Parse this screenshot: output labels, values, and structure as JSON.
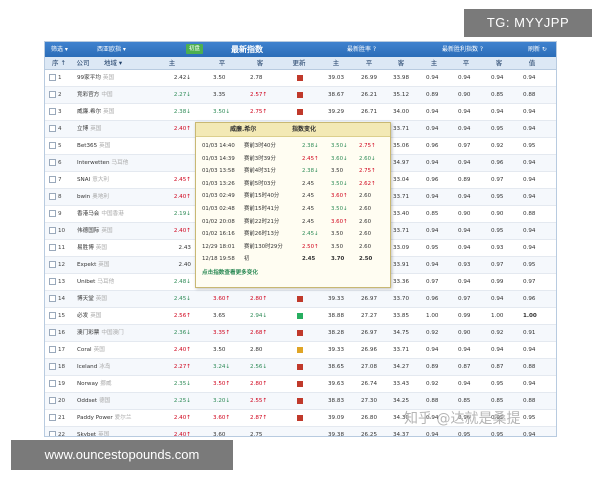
{
  "watermarks": {
    "top_right": "TG: MYYJPP",
    "bottom_left": "www.ouncestopounds.com",
    "zhihu": "知乎 @达就是桑提"
  },
  "toolbar": {
    "filter": "筛选 ▾",
    "region": "西亚欧指 ▾",
    "tag": "初盘",
    "title": "最新指数",
    "link1": "最新胜率 ?",
    "link2": "最新胜利指数 ?",
    "refresh": "刷新 ↻"
  },
  "header": {
    "seq": "序 ↑",
    "company": "公司",
    "region": "地域 ▾",
    "zhu": "主",
    "ping": "平",
    "ke": "客",
    "update": "更新",
    "zhu2": "主",
    "ping2": "平",
    "ke2": "客",
    "zhu3": "主",
    "ping3": "平",
    "ke3": "客",
    "val": "值"
  },
  "rows": [
    {
      "no": "1",
      "co": "99家平均",
      "rg": "英国",
      "zhu": "2.42↓",
      "zc": "blk",
      "ping": "3.50",
      "pc": "blk",
      "ke": "2.78",
      "kc": "blk",
      "upd": "#c0392b",
      "z2": "39.03",
      "p2": "26.99",
      "k2": "33.98",
      "z3": "0.94",
      "p3": "0.94",
      "k3": "0.94",
      "v": "0.94",
      "vb": false
    },
    {
      "no": "2",
      "co": "竞彩官方",
      "rg": "中国",
      "zhu": "2.27↓",
      "zc": "green",
      "ping": "3.35",
      "pc": "blk",
      "ke": "2.57↑",
      "kc": "red",
      "upd": "#c0392b",
      "z2": "38.67",
      "p2": "26.21",
      "k2": "35.12",
      "z3": "0.89",
      "p3": "0.90",
      "k3": "0.85",
      "v": "0.88",
      "vb": false
    },
    {
      "no": "3",
      "co": "威廉.希尔",
      "rg": "英国",
      "zhu": "2.38↓",
      "zc": "green",
      "ping": "3.50↓",
      "pc": "green",
      "ke": "2.75↑",
      "kc": "red",
      "upd": "#c0392b",
      "z2": "39.29",
      "p2": "26.71",
      "k2": "34.00",
      "z3": "0.94",
      "p3": "0.94",
      "k3": "0.94",
      "v": "0.94",
      "vb": false
    },
    {
      "no": "4",
      "co": "立博",
      "rg": "英国",
      "zhu": "2.40↑",
      "zc": "red",
      "ping": "3.50",
      "pc": "blk",
      "ke": "2.75↑",
      "kc": "red",
      "upd": "",
      "z2": "",
      "p2": "",
      "k2": "33.71",
      "z3": "0.94",
      "p3": "0.94",
      "k3": "0.95",
      "v": "0.94",
      "vb": false
    },
    {
      "no": "5",
      "co": "Bet365",
      "rg": "英国",
      "zhu": "",
      "zc": "blk",
      "ping": "",
      "pc": "blk",
      "ke": "",
      "kc": "blk",
      "upd": "",
      "z2": "",
      "p2": "",
      "k2": "35.06",
      "z3": "0.96",
      "p3": "0.97",
      "k3": "0.92",
      "v": "0.95",
      "vb": false
    },
    {
      "no": "6",
      "co": "Interwetten",
      "rg": "马耳他",
      "zhu": "",
      "zc": "blk",
      "ping": "",
      "pc": "blk",
      "ke": "",
      "kc": "blk",
      "upd": "",
      "z2": "",
      "p2": "",
      "k2": "34.97",
      "z3": "0.94",
      "p3": "0.94",
      "k3": "0.96",
      "v": "0.94",
      "vb": false
    },
    {
      "no": "7",
      "co": "SNAI",
      "rg": "意大利",
      "zhu": "2.45↑",
      "zc": "red",
      "ping": "",
      "pc": "blk",
      "ke": "",
      "kc": "blk",
      "upd": "",
      "z2": "",
      "p2": "",
      "k2": "33.04",
      "z3": "0.96",
      "p3": "0.89",
      "k3": "0.97",
      "v": "0.94",
      "vb": false
    },
    {
      "no": "8",
      "co": "bwin",
      "rg": "奥地利",
      "zhu": "2.40↑",
      "zc": "red",
      "ping": "",
      "pc": "blk",
      "ke": "",
      "kc": "blk",
      "upd": "",
      "z2": "",
      "p2": "",
      "k2": "33.71",
      "z3": "0.94",
      "p3": "0.94",
      "k3": "0.95",
      "v": "0.94",
      "vb": false
    },
    {
      "no": "9",
      "co": "香港马会",
      "rg": "中国香港",
      "zhu": "2.19↓",
      "zc": "green",
      "ping": "",
      "pc": "blk",
      "ke": "",
      "kc": "blk",
      "upd": "",
      "z2": "",
      "p2": "",
      "k2": "33.40",
      "z3": "0.85",
      "p3": "0.90",
      "k3": "0.90",
      "v": "0.88",
      "vb": false
    },
    {
      "no": "10",
      "co": "伟德国际",
      "rg": "英国",
      "zhu": "2.40↑",
      "zc": "red",
      "ping": "",
      "pc": "blk",
      "ke": "",
      "kc": "blk",
      "upd": "",
      "z2": "",
      "p2": "",
      "k2": "33.71",
      "z3": "0.94",
      "p3": "0.94",
      "k3": "0.95",
      "v": "0.94",
      "vb": false
    },
    {
      "no": "11",
      "co": "易胜博",
      "rg": "英国",
      "zhu": "2.43",
      "zc": "blk",
      "ping": "",
      "pc": "blk",
      "ke": "",
      "kc": "blk",
      "upd": "",
      "z2": "",
      "p2": "",
      "k2": "33.09",
      "z3": "0.95",
      "p3": "0.94",
      "k3": "0.93",
      "v": "0.94",
      "vb": false
    },
    {
      "no": "12",
      "co": "Expekt",
      "rg": "英国",
      "zhu": "2.40",
      "zc": "blk",
      "ping": "",
      "pc": "blk",
      "ke": "",
      "kc": "blk",
      "upd": "",
      "z2": "",
      "p2": "",
      "k2": "33.91",
      "z3": "0.94",
      "p3": "0.93",
      "k3": "0.97",
      "v": "0.95",
      "vb": false
    },
    {
      "no": "13",
      "co": "Unibet",
      "rg": "马耳他",
      "zhu": "2.48↓",
      "zc": "green",
      "ping": "3.50↑",
      "pc": "red",
      "ke": "2.90↑",
      "kc": "red",
      "upd": "#c0392b",
      "z2": "39.00",
      "p2": "27.64",
      "k2": "33.36",
      "z3": "0.97",
      "p3": "0.94",
      "k3": "0.99",
      "v": "0.97",
      "vb": false
    },
    {
      "no": "14",
      "co": "博天堂",
      "rg": "英国",
      "zhu": "2.45↓",
      "zc": "green",
      "ping": "3.60↑",
      "pc": "red",
      "ke": "2.80↑",
      "kc": "red",
      "upd": "#c0392b",
      "z2": "39.33",
      "p2": "26.97",
      "k2": "33.70",
      "z3": "0.96",
      "p3": "0.97",
      "k3": "0.94",
      "v": "0.96",
      "vb": false
    },
    {
      "no": "15",
      "co": "必发",
      "rg": "英国",
      "zhu": "2.56↑",
      "zc": "red",
      "ping": "3.65",
      "pc": "blk",
      "ke": "2.94↓",
      "kc": "green",
      "upd": "#27ae60",
      "z2": "38.88",
      "p2": "27.27",
      "k2": "33.85",
      "z3": "1.00",
      "p3": "0.99",
      "k3": "1.00",
      "v": "1.00",
      "vb": true
    },
    {
      "no": "16",
      "co": "澳门彩票",
      "rg": "中国澳门",
      "zhu": "2.36↓",
      "zc": "green",
      "ping": "3.35↑",
      "pc": "red",
      "ke": "2.68↑",
      "kc": "red",
      "upd": "#c0392b",
      "z2": "38.28",
      "p2": "26.97",
      "k2": "34.75",
      "z3": "0.92",
      "p3": "0.90",
      "k3": "0.92",
      "v": "0.91",
      "vb": false
    },
    {
      "no": "17",
      "co": "Coral",
      "rg": "英国",
      "zhu": "2.40↑",
      "zc": "red",
      "ping": "3.50",
      "pc": "blk",
      "ke": "2.80",
      "kc": "blk",
      "upd": "#e0a526",
      "z2": "39.33",
      "p2": "26.96",
      "k2": "33.71",
      "z3": "0.94",
      "p3": "0.94",
      "k3": "0.94",
      "v": "0.94",
      "vb": false
    },
    {
      "no": "18",
      "co": "Iceland",
      "rg": "冰岛",
      "zhu": "2.27↑",
      "zc": "red",
      "ping": "3.24↓",
      "pc": "green",
      "ke": "2.56↓",
      "kc": "green",
      "upd": "#c0392b",
      "z2": "38.65",
      "p2": "27.08",
      "k2": "34.27",
      "z3": "0.89",
      "p3": "0.87",
      "k3": "0.87",
      "v": "0.88",
      "vb": false
    },
    {
      "no": "19",
      "co": "Norway",
      "rg": "挪威",
      "zhu": "2.35↓",
      "zc": "green",
      "ping": "3.50↑",
      "pc": "red",
      "ke": "2.80↑",
      "kc": "red",
      "upd": "#c0392b",
      "z2": "39.63",
      "p2": "26.74",
      "k2": "33.43",
      "z3": "0.92",
      "p3": "0.94",
      "k3": "0.95",
      "v": "0.94",
      "vb": false
    },
    {
      "no": "20",
      "co": "Oddset",
      "rg": "德国",
      "zhu": "2.25↓",
      "zc": "green",
      "ping": "3.20↓",
      "pc": "green",
      "ke": "2.55↑",
      "kc": "red",
      "upd": "#c0392b",
      "z2": "38.83",
      "p2": "27.30",
      "k2": "34.25",
      "z3": "0.88",
      "p3": "0.85",
      "k3": "0.85",
      "v": "0.88",
      "vb": false
    },
    {
      "no": "21",
      "co": "Paddy Power",
      "rg": "爱尔兰",
      "zhu": "2.40↑",
      "zc": "red",
      "ping": "3.60↑",
      "pc": "red",
      "ke": "2.87↑",
      "kc": "red",
      "upd": "#c0392b",
      "z2": "39.09",
      "p2": "26.80",
      "k2": "34.30",
      "z3": "0.94",
      "p3": "0.96",
      "k3": "0.95",
      "v": "0.95",
      "vb": false
    },
    {
      "no": "22",
      "co": "Skybet",
      "rg": "英国",
      "zhu": "2.40↑",
      "zc": "red",
      "ping": "3.60",
      "pc": "blk",
      "ke": "2.75",
      "kc": "blk",
      "upd": "",
      "z2": "39.38",
      "p2": "26.25",
      "k2": "34.37",
      "z3": "0.94",
      "p3": "0.95",
      "k3": "0.95",
      "v": "0.94",
      "vb": false
    }
  ],
  "popup": {
    "company": "威廉.希尔",
    "title": "指数变化",
    "entries": [
      {
        "time": "01/03 14:40",
        "label": "赛前3时40分",
        "z": "2.38↓",
        "zc": "green",
        "p": "3.50↓",
        "pc": "green",
        "k": "2.75↑",
        "kc": "red"
      },
      {
        "time": "01/03 14:39",
        "label": "赛前3时39分",
        "z": "2.45↑",
        "zc": "red",
        "p": "3.60↓",
        "pc": "green",
        "k": "2.60↓",
        "kc": "green"
      },
      {
        "time": "01/03 13:58",
        "label": "赛前4时31分",
        "z": "2.38↓",
        "zc": "green",
        "p": "3.50",
        "pc": "blk",
        "k": "2.75↑",
        "kc": "red"
      },
      {
        "time": "01/03 13:26",
        "label": "赛前5时03分",
        "z": "2.45",
        "zc": "blk",
        "p": "3.50↓",
        "pc": "green",
        "k": "2.62↑",
        "kc": "red"
      },
      {
        "time": "01/03 02:49",
        "label": "赛前15时40分",
        "z": "2.45",
        "zc": "blk",
        "p": "3.60↑",
        "pc": "red",
        "k": "2.60",
        "kc": "blk"
      },
      {
        "time": "01/03 02:48",
        "label": "赛前15时41分",
        "z": "2.45",
        "zc": "blk",
        "p": "3.50↓",
        "pc": "green",
        "k": "2.60",
        "kc": "blk"
      },
      {
        "time": "01/02 20:08",
        "label": "赛前22时21分",
        "z": "2.45",
        "zc": "blk",
        "p": "3.60↑",
        "pc": "red",
        "k": "2.60",
        "kc": "blk"
      },
      {
        "time": "01/02 16:16",
        "label": "赛前26时13分",
        "z": "2.45↓",
        "zc": "green",
        "p": "3.50",
        "pc": "blk",
        "k": "2.60",
        "kc": "blk"
      },
      {
        "time": "12/29 18:01",
        "label": "赛前130时29分",
        "z": "2.50↑",
        "zc": "red",
        "p": "3.50",
        "pc": "blk",
        "k": "2.60",
        "kc": "blk"
      },
      {
        "time": "12/18 19:58",
        "label": "初",
        "z": "2.45",
        "zc": "blk",
        "p": "3.70",
        "pc": "blk",
        "k": "2.50",
        "kc": "blk"
      }
    ],
    "more_link": "点击指数查看更多变化"
  }
}
